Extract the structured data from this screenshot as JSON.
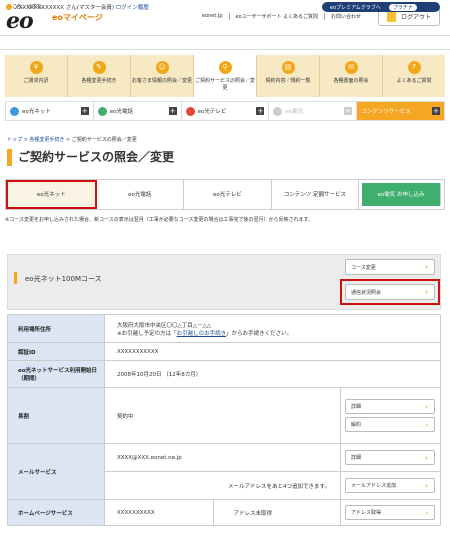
{
  "header": {
    "tagline": "ここち、はずむ。",
    "logo": "eo",
    "site_name": "eoマイページ",
    "links": [
      "eonet.jp",
      "eoユーザーサポート よくあるご質問",
      "お問い合わせ"
    ],
    "logout_label": "ログアウト"
  },
  "member": {
    "name": "XXXXXXXXXXXXX さん(マスター会員)",
    "login_history": "ログイン履歴",
    "premium_label": "eoプレミアムクラブへ",
    "premium_rank": "プラチナ"
  },
  "nav": [
    {
      "label": "ご請求内訳",
      "icon": "yen-icon",
      "glyph": "¥"
    },
    {
      "label": "各種変更手続き",
      "icon": "pencil-icon",
      "glyph": "✎"
    },
    {
      "label": "お客さま情報の照会／変更",
      "icon": "person-icon",
      "glyph": "☺"
    },
    {
      "label": "ご契約サービスの照会／変更",
      "icon": "search-icon",
      "glyph": "⚲"
    },
    {
      "label": "契約内容／規約一覧",
      "icon": "document-icon",
      "glyph": "▤"
    },
    {
      "label": "各種書面の照会",
      "icon": "mail-icon",
      "glyph": "✉"
    },
    {
      "label": "よくあるご質問",
      "icon": "question-icon",
      "glyph": "?"
    }
  ],
  "services": [
    {
      "label": "eo光ネット",
      "color": "#3b9ad9"
    },
    {
      "label": "eo光電話",
      "color": "#3fae6e"
    },
    {
      "label": "eo光テレビ",
      "color": "#e3453a"
    },
    {
      "label": "eo電気",
      "color": "#cccccc"
    },
    {
      "label": "コンテンツサービス",
      "color": "#f5a623"
    }
  ],
  "breadcrumb": [
    "トップ",
    "各種変更手続き",
    "ご契約サービスの照会／変更"
  ],
  "page_title": "ご契約サービスの照会／変更",
  "subtabs": [
    "eo光ネット",
    "eo光電話",
    "eo光テレビ",
    "コンテンツ 定額サービス",
    "eo電気 お申し込み"
  ],
  "note": "※コース変更をお申し込みされた場合、新コースの表示は翌月（工事が必要なコース変更の場合は工事完了後の翌月）から反映されます。",
  "plan": {
    "name": "eo光ネット100Mコース",
    "course_change": "コース変更",
    "comm_status": "通信状況照会"
  },
  "table": {
    "address_h": "利用場所住所",
    "address_v": "大阪府大阪市中央区〇〇△丁目△－△△",
    "address_note_pre": "※お引越し予定の方は「",
    "address_note_link": "お引越しのお手続き",
    "address_note_post": "」からお手続きください。",
    "auth_h": "認証ID",
    "auth_v": "XXXXXXXXXXX",
    "start_h": "eo光ネットサービス利用開始日（期間）",
    "start_v": "2008年10月20日 （12年8カ月）",
    "long_h": "長割",
    "long_v": "契約中",
    "long_btn1": "詳細",
    "long_btn2": "解約",
    "mail_h": "メールサービス",
    "mail_v": "XXXX@XXX.eonet.ne.jp",
    "mail_btn1": "詳細",
    "mail_note": "メールアドレスをあと4つ追加できます。",
    "mail_btn2": "メールアドレス追加",
    "hp_h": "ホームページサービス",
    "hp_v": "XXXXXXXXXX",
    "hp_status": "アドレス未取得",
    "hp_btn": "アドレス取得"
  }
}
